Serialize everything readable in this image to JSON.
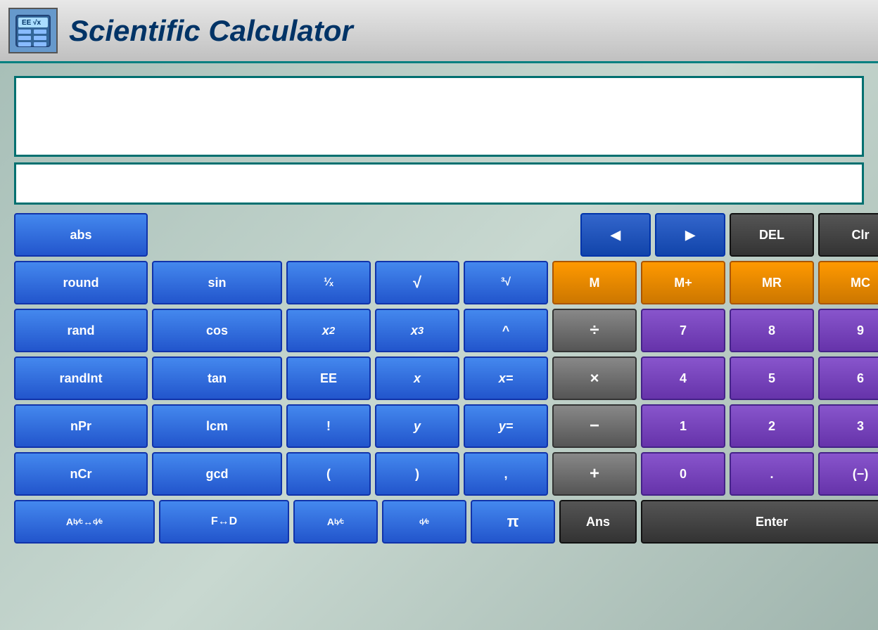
{
  "title": {
    "text": "Scientific Calculator",
    "icon_label": "calc-icon"
  },
  "displays": {
    "main_placeholder": "",
    "secondary_placeholder": ""
  },
  "buttons": {
    "row0": [
      {
        "label": "abs",
        "type": "blue",
        "name": "abs-btn"
      },
      {
        "label": "◀",
        "type": "nav",
        "name": "left-arrow-btn"
      },
      {
        "label": "▶",
        "type": "nav",
        "name": "right-arrow-btn"
      },
      {
        "label": "DEL",
        "type": "dark",
        "name": "del-btn"
      },
      {
        "label": "Clr",
        "type": "dark",
        "name": "clr-btn"
      }
    ],
    "row1": [
      {
        "label": "round",
        "type": "blue",
        "name": "round-btn"
      },
      {
        "label": "sin",
        "type": "blue",
        "name": "sin-btn"
      },
      {
        "label": "¹∕ₓ",
        "type": "blue",
        "name": "reciprocal-btn"
      },
      {
        "label": "√",
        "type": "blue",
        "name": "sqrt-btn"
      },
      {
        "label": "³√",
        "type": "blue",
        "name": "cbrt-btn"
      },
      {
        "label": "M",
        "type": "orange",
        "name": "m-btn"
      },
      {
        "label": "M+",
        "type": "orange",
        "name": "mplus-btn"
      },
      {
        "label": "MR",
        "type": "orange",
        "name": "mr-btn"
      },
      {
        "label": "MC",
        "type": "orange",
        "name": "mc-btn"
      }
    ],
    "row2": [
      {
        "label": "rand",
        "type": "blue",
        "name": "rand-btn"
      },
      {
        "label": "cos",
        "type": "blue",
        "name": "cos-btn"
      },
      {
        "label": "x²",
        "type": "blue",
        "name": "xsq-btn"
      },
      {
        "label": "x³",
        "type": "blue",
        "name": "xcb-btn"
      },
      {
        "label": "^",
        "type": "blue",
        "name": "pow-btn"
      },
      {
        "label": "÷",
        "type": "gray",
        "name": "div-btn"
      },
      {
        "label": "7",
        "type": "purple",
        "name": "7-btn"
      },
      {
        "label": "8",
        "type": "purple",
        "name": "8-btn"
      },
      {
        "label": "9",
        "type": "purple",
        "name": "9-btn"
      }
    ],
    "row3": [
      {
        "label": "randInt",
        "type": "blue",
        "name": "randint-btn"
      },
      {
        "label": "tan",
        "type": "blue",
        "name": "tan-btn"
      },
      {
        "label": "EE",
        "type": "blue",
        "name": "ee-btn"
      },
      {
        "label": "x",
        "type": "blue",
        "name": "x-btn"
      },
      {
        "label": "x=",
        "type": "blue",
        "name": "xeq-btn"
      },
      {
        "label": "×",
        "type": "gray",
        "name": "mul-btn"
      },
      {
        "label": "4",
        "type": "purple",
        "name": "4-btn"
      },
      {
        "label": "5",
        "type": "purple",
        "name": "5-btn"
      },
      {
        "label": "6",
        "type": "purple",
        "name": "6-btn"
      }
    ],
    "row4": [
      {
        "label": "nPr",
        "type": "blue",
        "name": "npr-btn"
      },
      {
        "label": "lcm",
        "type": "blue",
        "name": "lcm-btn"
      },
      {
        "label": "!",
        "type": "blue",
        "name": "fact-btn"
      },
      {
        "label": "y",
        "type": "blue",
        "name": "y-btn"
      },
      {
        "label": "y=",
        "type": "blue",
        "name": "yeq-btn"
      },
      {
        "label": "−",
        "type": "gray",
        "name": "sub-btn"
      },
      {
        "label": "1",
        "type": "purple",
        "name": "1-btn"
      },
      {
        "label": "2",
        "type": "purple",
        "name": "2-btn"
      },
      {
        "label": "3",
        "type": "purple",
        "name": "3-btn"
      }
    ],
    "row5": [
      {
        "label": "nCr",
        "type": "blue",
        "name": "ncr-btn"
      },
      {
        "label": "gcd",
        "type": "blue",
        "name": "gcd-btn"
      },
      {
        "label": "(",
        "type": "blue",
        "name": "lparen-btn"
      },
      {
        "label": ")",
        "type": "blue",
        "name": "rparen-btn"
      },
      {
        "label": ",",
        "type": "blue",
        "name": "comma-btn"
      },
      {
        "label": "+",
        "type": "gray",
        "name": "add-btn"
      },
      {
        "label": "0",
        "type": "purple",
        "name": "0-btn"
      },
      {
        "label": ".",
        "type": "purple",
        "name": "dot-btn"
      },
      {
        "label": "(−)",
        "type": "purple",
        "name": "neg-btn"
      }
    ],
    "row6": [
      {
        "label": "Aᵇ∕꜀ ↔ ᵈ∕ₑ",
        "type": "blue",
        "name": "fracconv-btn"
      },
      {
        "label": "F↔D",
        "type": "blue",
        "name": "fd-btn"
      },
      {
        "label": "Aᵇ∕꜀",
        "type": "blue",
        "name": "frac-btn"
      },
      {
        "label": "ᵈ∕ₑ",
        "type": "blue",
        "name": "de-btn"
      },
      {
        "label": "π",
        "type": "blue",
        "name": "pi-btn"
      },
      {
        "label": "Ans",
        "type": "dark",
        "name": "ans-btn"
      },
      {
        "label": "Enter",
        "type": "dark",
        "name": "enter-btn"
      }
    ]
  }
}
